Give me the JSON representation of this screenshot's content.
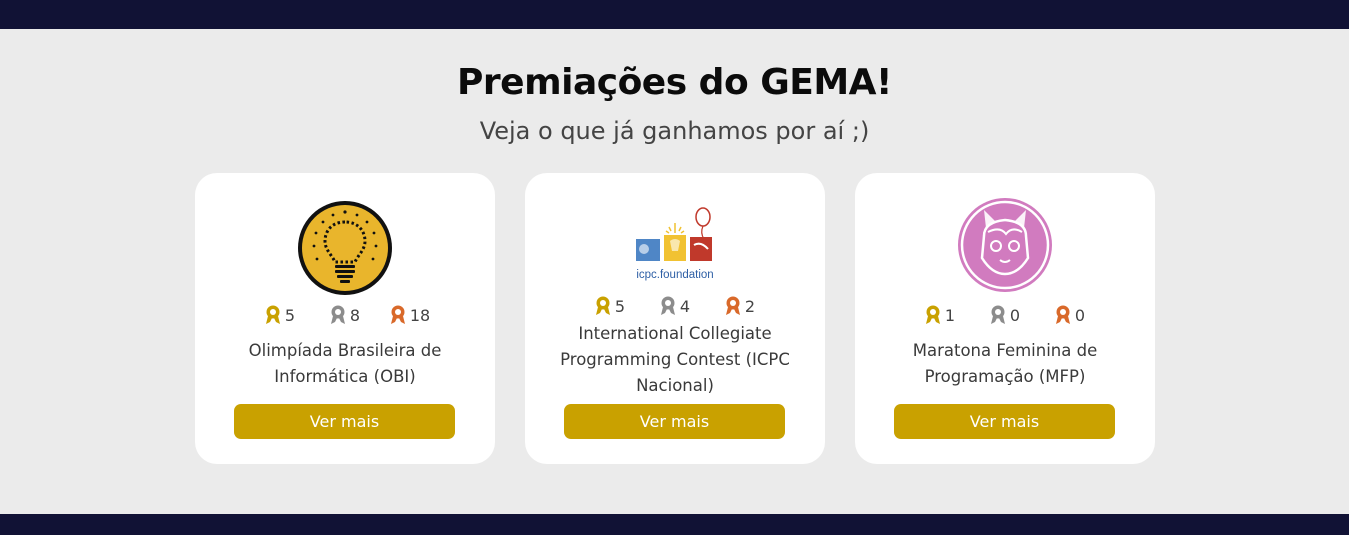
{
  "header": {
    "title": "Premiações do GEMA!",
    "subtitle": "Veja o que já ganhamos por aí ;)"
  },
  "colors": {
    "gold": "#c9a100",
    "silver": "#8c8c8c",
    "bronze": "#d9692a",
    "bar": "#111235",
    "button": "#c9a100"
  },
  "cards": [
    {
      "logo": "lightbulb-icon",
      "medals": {
        "gold": "5",
        "silver": "8",
        "bronze": "18"
      },
      "name_line1": "Olimpíada Brasileira de",
      "name_line2": "Informática (OBI)",
      "button_label": "Ver mais"
    },
    {
      "logo": "icpc-foundation-logo",
      "logo_text": "icpc.foundation",
      "medals": {
        "gold": "5",
        "silver": "4",
        "bronze": "2"
      },
      "name_line1": "International Collegiate",
      "name_line2": "Programming Contest (ICPC",
      "name_line3": "Nacional)",
      "button_label": "Ver mais"
    },
    {
      "logo": "cat-girl-avatar",
      "medals": {
        "gold": "1",
        "silver": "0",
        "bronze": "0"
      },
      "name_line1": "Maratona Feminina de",
      "name_line2": "Programação (MFP)",
      "button_label": "Ver mais"
    }
  ]
}
